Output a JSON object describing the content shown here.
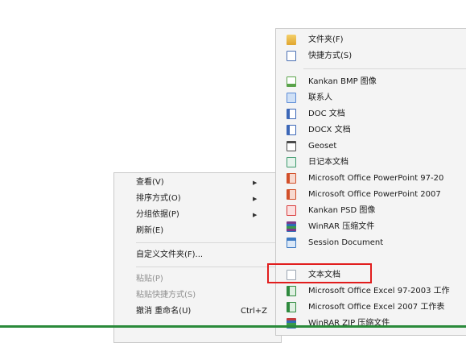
{
  "context_menu": {
    "items": [
      {
        "label": "查看(V)",
        "has_submenu": true,
        "disabled": false
      },
      {
        "label": "排序方式(O)",
        "has_submenu": true,
        "disabled": false
      },
      {
        "label": "分组依据(P)",
        "has_submenu": true,
        "disabled": false
      },
      {
        "label": "刷新(E)",
        "has_submenu": false,
        "disabled": false
      },
      {
        "label": "自定义文件夹(F)...",
        "has_submenu": false,
        "disabled": false
      },
      {
        "label": "粘贴(P)",
        "has_submenu": false,
        "disabled": true
      },
      {
        "label": "粘贴快捷方式(S)",
        "has_submenu": false,
        "disabled": true
      },
      {
        "label": "撤消 重命名(U)",
        "shortcut": "Ctrl+Z",
        "disabled": false
      }
    ]
  },
  "new_submenu": {
    "items": [
      {
        "label": "文件夹(F)",
        "icon": "folder-icon",
        "color": "#e8b23c"
      },
      {
        "label": "快捷方式(S)",
        "icon": "shortcut-icon",
        "color": "#4a6fb3"
      },
      {
        "label": "Kankan BMP 图像",
        "icon": "bmp-image-icon",
        "color": "#5aa34a"
      },
      {
        "label": "联系人",
        "icon": "contact-icon",
        "color": "#5b8bd6"
      },
      {
        "label": "DOC 文档",
        "icon": "doc-icon",
        "color": "#3c67b7"
      },
      {
        "label": "DOCX 文档",
        "icon": "docx-icon",
        "color": "#3c67b7"
      },
      {
        "label": "Geoset",
        "icon": "geoset-icon",
        "color": "#4a4a4a"
      },
      {
        "label": "日记本文档",
        "icon": "journal-icon",
        "color": "#3e9a6e"
      },
      {
        "label": "Microsoft Office PowerPoint 97-20",
        "icon": "powerpoint-icon",
        "color": "#d2502a"
      },
      {
        "label": "Microsoft Office PowerPoint 2007",
        "icon": "powerpoint-icon",
        "color": "#d2502a"
      },
      {
        "label": "Kankan PSD 图像",
        "icon": "psd-image-icon",
        "color": "#d93a3a"
      },
      {
        "label": "WinRAR 压缩文件",
        "icon": "winrar-icon",
        "color": "#7a3a8a"
      },
      {
        "label": "Session Document",
        "icon": "session-document-icon",
        "color": "#3d7ac4"
      },
      {
        "label": "文本文档",
        "icon": "text-document-icon",
        "color": "#bfc7d1"
      },
      {
        "label": "Microsoft Office Excel 97-2003 工作",
        "icon": "excel-icon",
        "color": "#2f8a3e"
      },
      {
        "label": "Microsoft Office Excel 2007 工作表",
        "icon": "excel-icon",
        "color": "#2f8a3e"
      },
      {
        "label": "WinRAR ZIP 压缩文件",
        "icon": "winrar-zip-icon",
        "color": "#c43a3a"
      }
    ]
  },
  "highlight_color": "#e11d1d"
}
